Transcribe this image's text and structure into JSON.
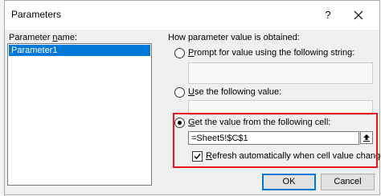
{
  "dialog": {
    "title": "Parameters",
    "help_label": "?"
  },
  "parameter_name": {
    "label_access": "n",
    "label_pre": "Parameter ",
    "label_post": "ame:",
    "items": [
      "Parameter1"
    ]
  },
  "value_source": {
    "group_label": "How parameter value is obtained:",
    "prompt_access": "P",
    "prompt_rest": "rompt for value using the following string:",
    "prompt_value": "",
    "fixed_access": "U",
    "fixed_rest": "se the following value:",
    "fixed_value": "",
    "cell_access": "G",
    "cell_rest": "et the value from the following cell:",
    "cell_value": "=Sheet5!$C$1",
    "refresh_access": "R",
    "refresh_rest": "efresh automatically when cell value changes",
    "selected": "cell",
    "refresh_checked": true
  },
  "buttons": {
    "ok": "OK",
    "cancel": "Cancel"
  },
  "colors": {
    "highlight": "#e8171d",
    "selection": "#0078d7"
  }
}
